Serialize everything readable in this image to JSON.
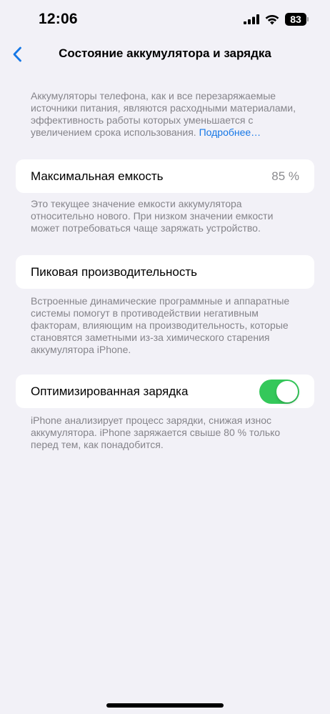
{
  "status_bar": {
    "time": "12:06",
    "battery_level": "83",
    "icons": [
      "signal-icon",
      "wifi-icon",
      "battery-icon"
    ]
  },
  "nav": {
    "back_icon": "chevron-left-icon",
    "title": "Состояние аккумулятора и зарядка"
  },
  "intro": {
    "text": "Аккумуляторы телефона, как и все перезаряжаемые источники питания, являются расходными материалами, эффективность работы которых уменьшается с увеличением срока использования. ",
    "link_label": "Подробнее…"
  },
  "max_capacity": {
    "label": "Максимальная емкость",
    "value": "85 %",
    "description": "Это текущее значение емкости аккумулятора относительно нового. При низком значении емкости может потребоваться чаще заряжать устройство."
  },
  "peak_performance": {
    "label": "Пиковая производительность",
    "description": "Встроенные динамические программные и аппаратные системы помогут в противодействии негативным факторам, влияющим на производительность, которые становятся заметными из-за химического старения аккумулятора iPhone."
  },
  "optimized_charging": {
    "label": "Оптимизированная зарядка",
    "enabled": true,
    "description": "iPhone анализирует процесс зарядки, снижая износ аккумулятора. iPhone заряжается свыше 80 % только перед тем, как понадобится."
  },
  "colors": {
    "background": "#f2f1f7",
    "accent": "#1577e6",
    "toggle_on": "#34c85a",
    "secondary_text": "#85848a"
  }
}
